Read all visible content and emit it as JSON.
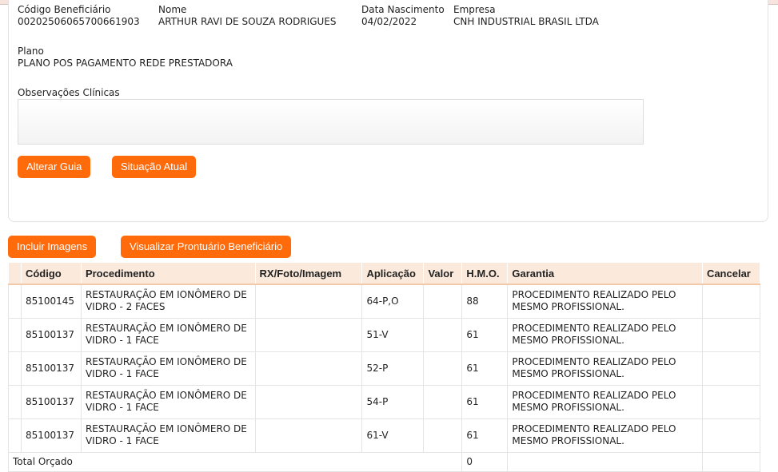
{
  "beneficiary": {
    "codigo_label": "Código Beneficiário",
    "codigo": "00202506065700661903",
    "nome_label": "Nome",
    "nome": "ARTHUR RAVI DE SOUZA RODRIGUES",
    "nasc_label": "Data Nascimento",
    "nasc": "04/02/2022",
    "empresa_label": "Empresa",
    "empresa": "CNH INDUSTRIAL BRASIL LTDA",
    "plano_label": "Plano",
    "plano": "PLANO POS PAGAMENTO REDE PRESTADORA",
    "obs_label": "Observações Clínicas"
  },
  "buttons": {
    "alterar": "Alterar Guia",
    "situacao": "Situação Atual",
    "incluir": "Incluir Imagens",
    "visualizar": "Visualizar Prontuário Beneficiário"
  },
  "table": {
    "headers": [
      "Código",
      "Procedimento",
      "RX/Foto/Imagem",
      "Aplicação",
      "Valor",
      "H.M.O.",
      "Garantia",
      "Cancelar"
    ],
    "rows": [
      {
        "codigo": "85100145",
        "proc": "RESTAURAÇÃO EM IONÔMERO DE VIDRO - 2 FACES",
        "apl": "64-P,O",
        "hmo": "88",
        "gar": "PROCEDIMENTO REALIZADO PELO MESMO PROFISSIONAL."
      },
      {
        "codigo": "85100137",
        "proc": "RESTAURAÇÃO EM IONÔMERO DE VIDRO - 1 FACE",
        "apl": "51-V",
        "hmo": "61",
        "gar": "PROCEDIMENTO REALIZADO PELO MESMO PROFISSIONAL."
      },
      {
        "codigo": "85100137",
        "proc": "RESTAURAÇÃO EM IONÔMERO DE VIDRO - 1 FACE",
        "apl": "52-P",
        "hmo": "61",
        "gar": "PROCEDIMENTO REALIZADO PELO MESMO PROFISSIONAL."
      },
      {
        "codigo": "85100137",
        "proc": "RESTAURAÇÃO EM IONÔMERO DE VIDRO - 1 FACE",
        "apl": "54-P",
        "hmo": "61",
        "gar": "PROCEDIMENTO REALIZADO PELO MESMO PROFISSIONAL."
      },
      {
        "codigo": "85100137",
        "proc": "RESTAURAÇÃO EM IONÔMERO DE VIDRO - 1 FACE",
        "apl": "61-V",
        "hmo": "61",
        "gar": "PROCEDIMENTO REALIZADO PELO MESMO PROFISSIONAL."
      }
    ],
    "total_label": "Total Orçado",
    "total_hmo": "0"
  }
}
